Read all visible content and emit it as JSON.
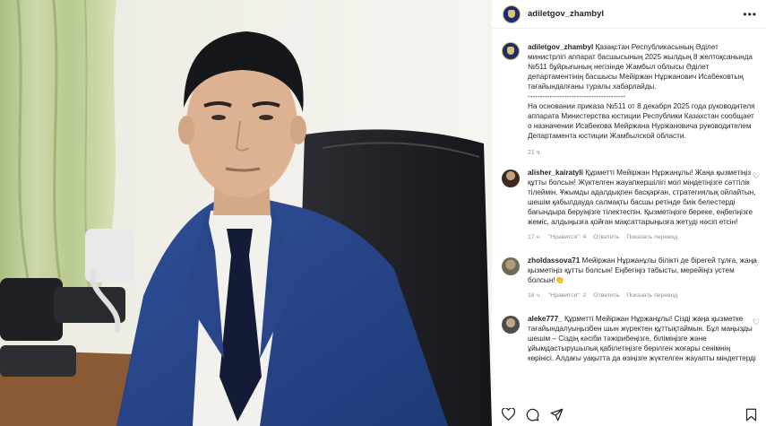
{
  "post": {
    "username": "adiletgov_zhambyl",
    "caption_kk": "Қазақстан Республикасының Әділет министрлігі аппарат басшысының 2025 жылдың 8 желтоқсанында №511 бұйрығының негізінде Жамбыл облысы Әділет департаментінің басшысы Мейіржан Нұржанович Исабековтың тағайындалғаны туралы хабарлайды.",
    "separator": "----------------------------------------",
    "caption_ru": "На основании приказа №511 от 8 декабря 2025 года руководителя аппарата Министерства юстиции Республики Казахстан сообщает о назначении Исабекова Мейржана Нуржановича руководителем Департамента юстиции Жамбылской области.",
    "time": "21 ч."
  },
  "comments": [
    {
      "username": "alisher_kairatyli",
      "text": "Құрметті Мейіржан Нұржанұлы! Жаңа қызметіңіз құтты болсын! Жүктелген жауапкершілігі мол міндетіңізге сәттілік тілеймін. Ұжымды адалдықпен басқарған, стратегиялық ойлайтын, шешім қабылдауда салмақты басшы ретінде биік белестерді бағындыра беруіңізге тілектеспін. Қызметіңізге береке, еңбегіңізге жеміс, алдыңызға қойған мақсаттарыңызға жетуді нәсіп етсін!",
      "time": "17 ч.",
      "likes": "\"Нравится\": 4",
      "reply": "Ответить",
      "translate": "Показать перевод"
    },
    {
      "username": "zholdassova71",
      "text": "Мейіржан Нұржанұлы білікті де бірегей тұлға, жаңа қызметіңіз құтты болсын! Еңбегіңіз табысты, мерейіңіз үстем болсын!👏",
      "time": "18 ч.",
      "likes": "\"Нравится\": 2",
      "reply": "Ответить",
      "translate": "Показать перевод"
    },
    {
      "username": "aleke777_",
      "text": "Құрметті Мейіржан Нұржанұлы! Сізді жаңа қызметке тағайындалуыңызбен шын жүректен құттықтаймын. Бұл маңызды шешім – Сіздің кәсіби тәжірибеңізге, біліміңізге және ұйымдастырушылық қабілетіңізге берілген жоғары сенімнің көрінісі. Алдағы уақытта да өзіңізге жүктелген жауапты міндеттерді",
      "time": "",
      "likes": "",
      "reply": "",
      "translate": ""
    }
  ],
  "icons": {
    "like": "heart-icon",
    "comment": "comment-icon",
    "share": "share-icon",
    "save": "bookmark-icon",
    "more": "more-icon"
  },
  "colors": {
    "accent_text": "#262626",
    "muted_text": "#8e8e8e",
    "avatar_bg": "#1d2d6b"
  }
}
